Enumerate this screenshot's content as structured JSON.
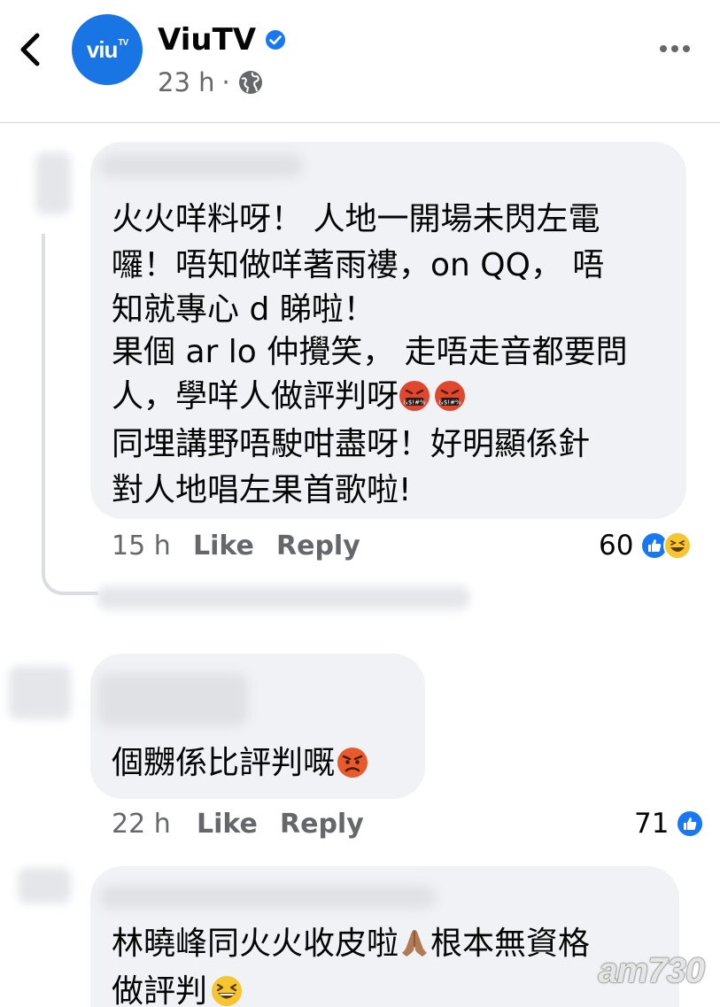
{
  "header": {
    "back_icon": "chevron-left-icon",
    "avatar_logo": "viu",
    "page_name": "ViuTV",
    "verified_icon": "verified-badge-icon",
    "time": "23 h",
    "separator": "·",
    "audience_icon": "globe-icon",
    "more_icon": "more-dots-icon"
  },
  "comments": [
    {
      "lines": [
        "火火咩料呀！ 人地一開場未閃左電",
        "囉！唔知做咩著雨褸，on QQ， 唔",
        "知就專心 d 睇啦！",
        "果個 ar lo 仲攪笑， 走唔走音都要問",
        "人，學咩人做評判呀",
        "同埋講野唔駛咁盡呀！好明顯係針",
        "對人地唱左果首歌啦!"
      ],
      "time": "15 h",
      "like_label": "Like",
      "reply_label": "Reply",
      "reaction_count": "60",
      "reaction_icons": [
        "like-reaction-icon",
        "haha-reaction-icon"
      ],
      "inline_emojis": [
        "cursing-face-emoji",
        "cursing-face-emoji"
      ]
    },
    {
      "lines": [
        "個嬲係比評判嘅"
      ],
      "time": "22 h",
      "like_label": "Like",
      "reply_label": "Reply",
      "reaction_count": "71",
      "reaction_icons": [
        "like-reaction-icon"
      ],
      "inline_emojis": [
        "angry-face-emoji"
      ]
    },
    {
      "lines": [
        "林曉峰同火火收皮啦",
        "根本無資格",
        "做評判"
      ],
      "inline_emojis": [
        "folded-hands-emoji",
        "grinning-squinting-face-emoji"
      ]
    }
  ],
  "watermark": "am730",
  "colors": {
    "brand_blue": "#1877f2",
    "viu_blue": "#1875e3",
    "bubble_bg": "#f0f2f5",
    "meta_gray": "#65676b",
    "text": "#050505"
  }
}
